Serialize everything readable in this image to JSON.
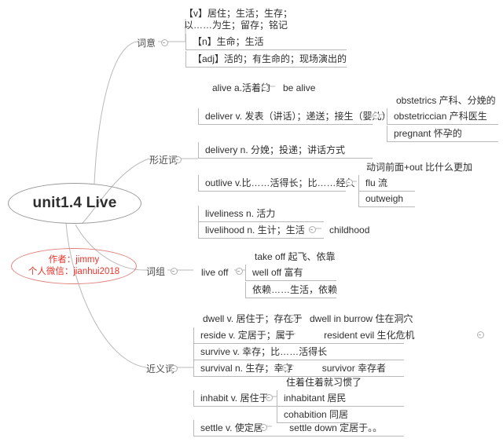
{
  "title": "unit1.4 Live",
  "center": {
    "label": "unit1.4 Live"
  },
  "author": {
    "line1": "作者：jimmy",
    "line2": "个人微信：jianhui2018",
    "color": "#e8342c"
  },
  "theme": {
    "line_color": "#b9b9b9",
    "text_color": "#2f2f2f",
    "label_color": "#4a4a4a",
    "accent_color": "#e8342c"
  },
  "branches": [
    {
      "id": "ciyi",
      "label": "词意",
      "children": [
        {
          "id": "ciyi-v",
          "text": "【v】居住；生活；生存；",
          "text2": "以……为生；留存；铭记"
        },
        {
          "id": "ciyi-n",
          "text": "【n】生命；生活"
        },
        {
          "id": "ciyi-adj",
          "text": "【adj】活的；有生命的；现场演出的"
        }
      ]
    },
    {
      "id": "xingjinci",
      "label": "形近词",
      "children": [
        {
          "id": "alive",
          "text": "alive  a.活着的",
          "child": "be  alive"
        },
        {
          "id": "deliver",
          "text": "deliver v. 发表（讲话）；递送；接生（婴儿）",
          "subs": [
            {
              "id": "obstetrics",
              "text": "obstetrics  产科、分娩的"
            },
            {
              "id": "obstetriccian",
              "text": "obstetriccian 产科医生"
            },
            {
              "id": "pregnant",
              "text": "pregnant  怀孕的"
            }
          ]
        },
        {
          "id": "delivery",
          "text": "delivery n. 分娩；投递；讲话方式"
        },
        {
          "id": "outlive",
          "text": "outlive v.比……活得长；比……经久",
          "subs": [
            {
              "id": "outnote",
              "text": "动词前面+out 比什么更加"
            },
            {
              "id": "flu",
              "text": "flu  流"
            },
            {
              "id": "outweigh",
              "text": "outweigh"
            }
          ]
        },
        {
          "id": "liveliness",
          "text": "liveliness n. 活力"
        },
        {
          "id": "livelihood",
          "text": "livelihood  n. 生计；生活",
          "child": "childhood"
        }
      ]
    },
    {
      "id": "cizu",
      "label": "词组",
      "children": [
        {
          "id": "live-off",
          "text": "live off",
          "subs": [
            {
              "id": "take-off",
              "text": "take off  起飞、依靠"
            },
            {
              "id": "well-off",
              "text": "well off   富有"
            },
            {
              "id": "liveoff-cn",
              "text": "依赖……生活，依赖"
            }
          ]
        }
      ]
    },
    {
      "id": "jinyici",
      "label": "近义词",
      "children": [
        {
          "id": "dwell",
          "text": "dwell v. 居住于；存在于",
          "child": "dwell in burrow 住在洞穴"
        },
        {
          "id": "reside",
          "text": "reside v.  定居于；属于",
          "child": "resident evil  生化危机"
        },
        {
          "id": "survive",
          "text": "survive v.  幸存；比……活得长"
        },
        {
          "id": "survival",
          "text": "survival n. 生存；幸存",
          "child": "survivor 幸存者"
        },
        {
          "id": "inhabit",
          "text": "inhabit v.  居住于",
          "subs": [
            {
              "id": "inhabit-note",
              "text": "住着住着就习惯了"
            },
            {
              "id": "inhabitant",
              "text": "inhabitant  居民"
            },
            {
              "id": "cohabition",
              "text": "cohabition 同居"
            }
          ]
        },
        {
          "id": "settle",
          "text": "settle  v.  使定居",
          "child": "settle down 定居于。。"
        }
      ]
    }
  ]
}
